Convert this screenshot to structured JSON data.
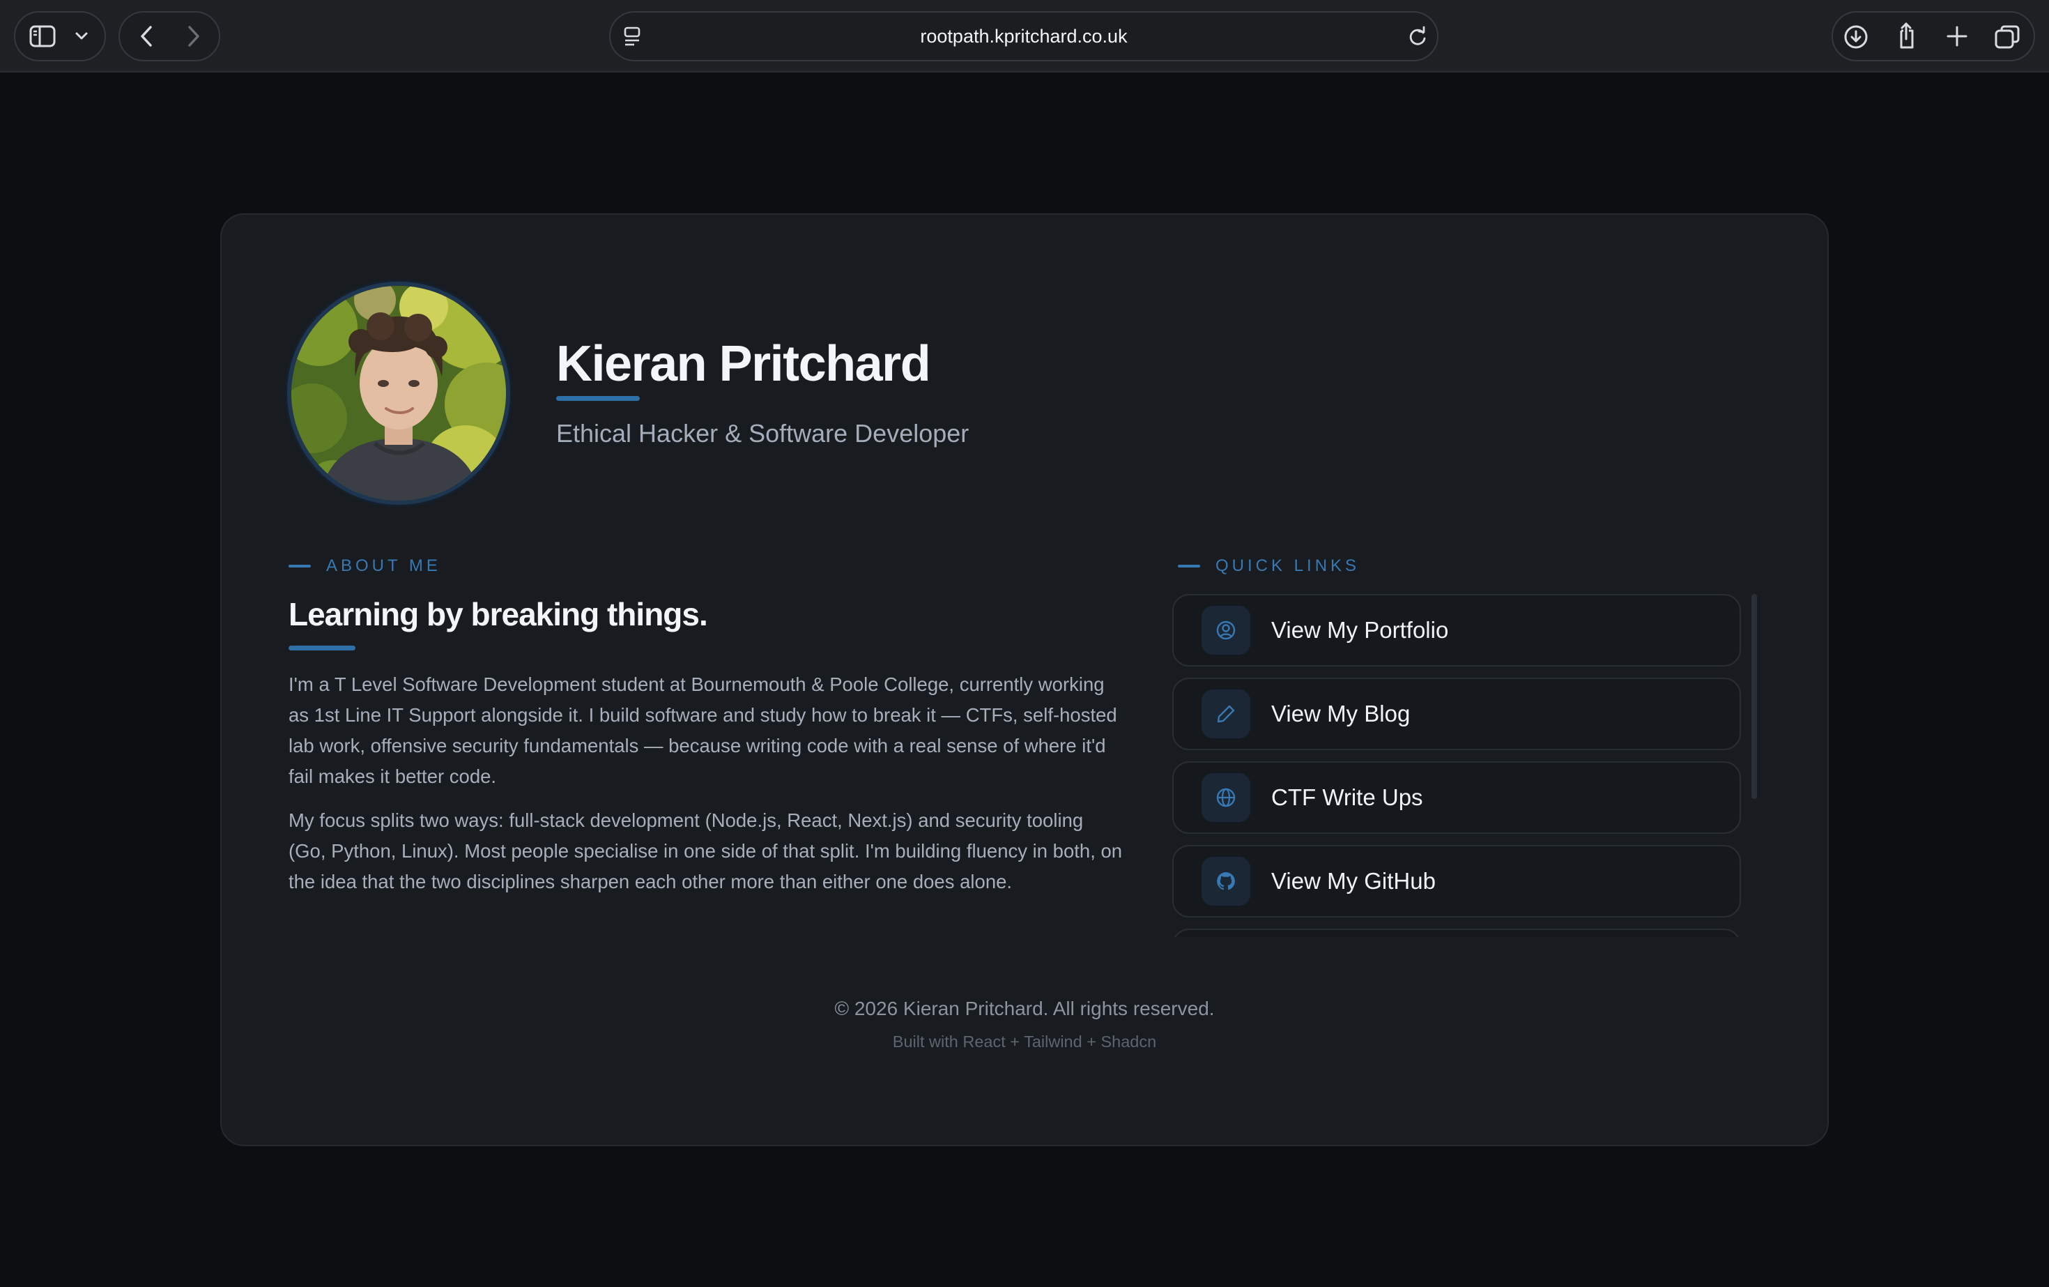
{
  "browser": {
    "url": "rootpath.kpritchard.co.uk"
  },
  "profile": {
    "name": "Kieran Pritchard",
    "title": "Ethical Hacker & Software Developer"
  },
  "about": {
    "label": "ABOUT ME",
    "heading": "Learning by breaking things.",
    "paragraphs": [
      "I'm a T Level Software Development student at Bournemouth & Poole College, currently working as 1st Line IT Support alongside it. I build software and study how to break it — CTFs, self-hosted lab work, offensive security fundamentals — because writing code with a real sense of where it'd fail makes it better code.",
      "My focus splits two ways: full-stack development (Node.js, React, Next.js) and security tooling (Go, Python, Linux). Most people specialise in one side of that split. I'm building fluency in both, on the idea that the two disciplines sharpen each other more than either one does alone."
    ]
  },
  "quick_links": {
    "label": "QUICK LINKS",
    "items": [
      {
        "label": "View My Portfolio",
        "icon": "user-circle-icon"
      },
      {
        "label": "View My Blog",
        "icon": "pencil-icon"
      },
      {
        "label": "CTF Write Ups",
        "icon": "globe-icon"
      },
      {
        "label": "View My GitHub",
        "icon": "github-icon"
      }
    ]
  },
  "footer": {
    "copyright": "© 2026 Kieran Pritchard. All rights reserved.",
    "built_with": "Built with React + Tailwind + Shadcn"
  },
  "colors": {
    "background": "#0c0e12",
    "card": "#181b20",
    "accent": "#3878b3",
    "text_primary": "#f3f5f8",
    "text_muted": "#a7afbb"
  }
}
